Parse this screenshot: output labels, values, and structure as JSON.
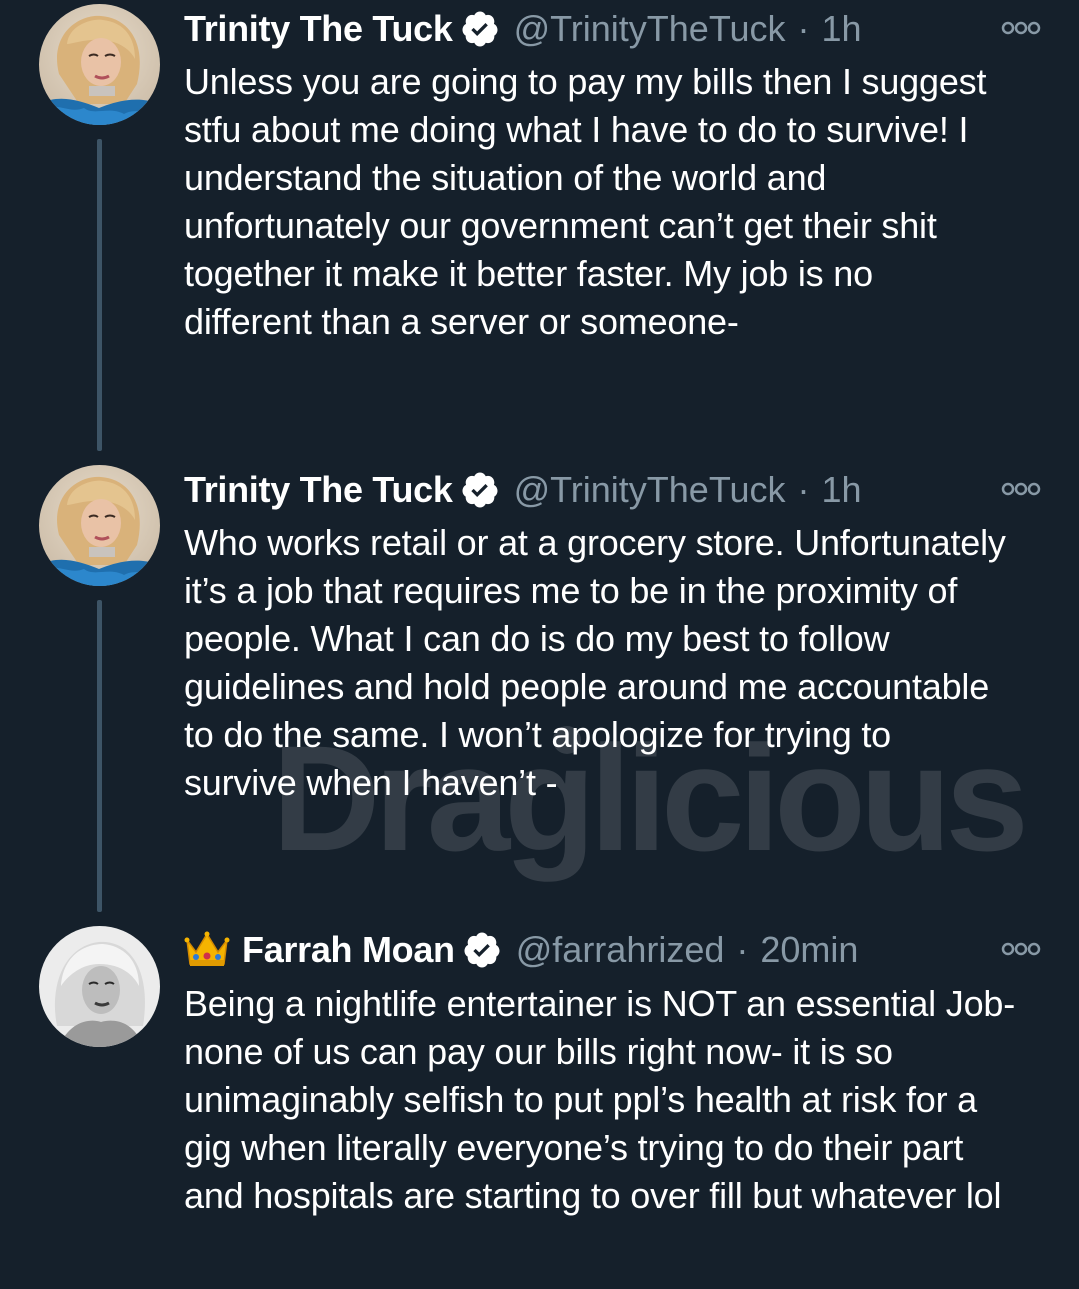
{
  "tweets": [
    {
      "name": "Trinity The Tuck",
      "handle": "@TrinityTheTuck",
      "separator": "·",
      "time": "1h",
      "text": "Unless you are going to pay my bills then I suggest\nstfu about me doing what I have to do to survive! I\nunderstand the situation of the world and\nunfortunately our government can’t get their shit\ntogether it make it better faster. My job is no\ndifferent than a server or someone-",
      "avatar_icon": "profile-photo-trinity",
      "verified_icon": "verified-badge-icon",
      "more_icon": "more-options-icon"
    },
    {
      "name": "Trinity The Tuck",
      "handle": "@TrinityTheTuck",
      "separator": "·",
      "time": "1h",
      "text": "Who works retail or at a grocery store. Unfortunately\nit’s a job that requires me to be in the proximity of\npeople. What I can do is do my best to follow\nguidelines and hold people around me accountable\nto do the same. I won’t apologize for trying to\nsurvive when I haven’t -",
      "avatar_icon": "profile-photo-trinity",
      "verified_icon": "verified-badge-icon",
      "more_icon": "more-options-icon"
    },
    {
      "name_emoji": "crown-emoji",
      "name": "Farrah Moan",
      "handle": "@farrahrized",
      "separator": "·",
      "time": "20min",
      "text": "Being a nightlife entertainer is NOT an essential Job-\nnone of us can pay our bills right now- it is so\nunimaginably selfish to put ppl’s health at risk for a\ngig when literally everyone’s trying to do their part\nand hospitals are starting to over fill but whatever lol",
      "avatar_icon": "profile-photo-farrah",
      "verified_icon": "verified-badge-icon",
      "more_icon": "more-options-icon"
    }
  ],
  "watermark": {
    "text": "Draglicious",
    "icon": "watermark-logo"
  },
  "colors": {
    "background": "#15202b",
    "primary_text": "#ffffff",
    "secondary_text": "#8899a6",
    "thread_line": "#3d5466"
  }
}
